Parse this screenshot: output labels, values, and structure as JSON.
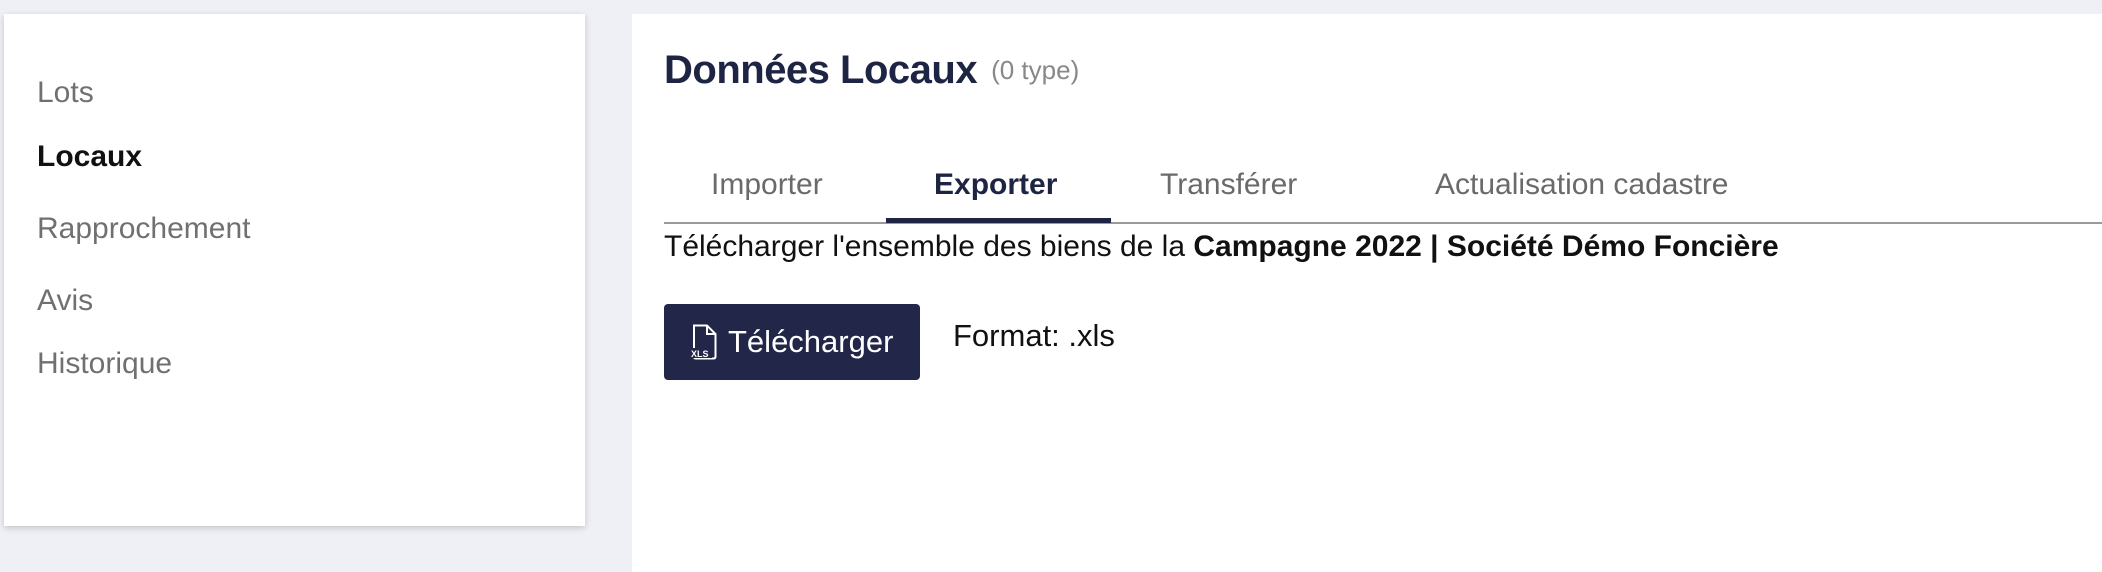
{
  "sidebar": {
    "items": [
      {
        "label": "Lots"
      },
      {
        "label": "Locaux",
        "active": true
      },
      {
        "label": "Rapprochement"
      },
      {
        "label": "Avis"
      },
      {
        "label": "Historique"
      }
    ]
  },
  "header": {
    "title": "Données Locaux",
    "count": "(0 type)"
  },
  "tabs": [
    {
      "label": "Importer"
    },
    {
      "label": "Exporter",
      "active": true
    },
    {
      "label": "Transférer"
    },
    {
      "label": "Actualisation cadastre"
    }
  ],
  "export": {
    "description_prefix": "Télécharger l'ensemble des biens de la ",
    "description_bold": "Campagne 2022 | Société Démo Foncière",
    "button_label": "Télécharger",
    "button_icon": "xls-file-icon",
    "button_icon_text": "XLS",
    "format_text": "Format: .xls"
  },
  "colors": {
    "accent": "#22274a",
    "background": "#eef0f5",
    "inactive_text": "#707070"
  }
}
